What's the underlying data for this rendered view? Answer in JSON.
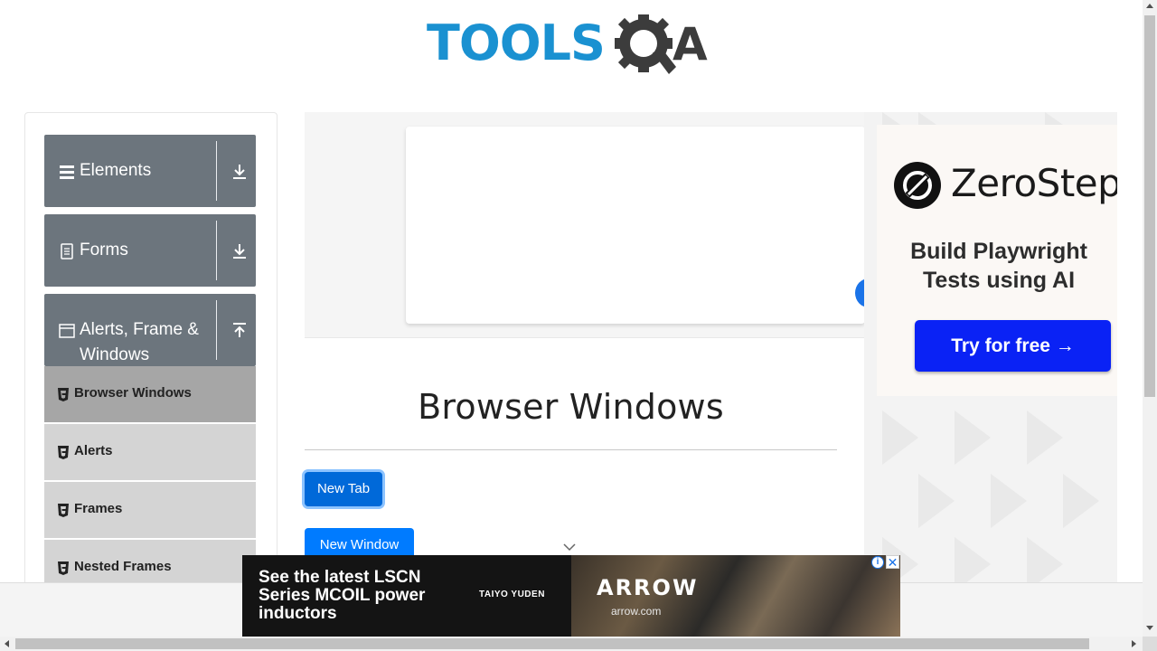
{
  "header": {
    "logo_text_left": "TOOLS",
    "logo_text_right": "A",
    "logo_icon": "gear-magnifier-icon"
  },
  "sidebar": {
    "groups": [
      {
        "label": "Elements",
        "icon": "hamburger-icon",
        "toggle_icon": "download-arrow-icon",
        "expanded": false
      },
      {
        "label": "Forms",
        "icon": "document-icon",
        "toggle_icon": "download-arrow-icon",
        "expanded": false
      },
      {
        "label_line1": "Alerts, Frame &",
        "label_line2": "Windows",
        "icon": "window-icon",
        "toggle_icon": "upload-arrow-icon",
        "expanded": true
      }
    ],
    "items": [
      {
        "label": "Browser Windows",
        "active": true,
        "icon": "html5-icon"
      },
      {
        "label": "Alerts",
        "active": false,
        "icon": "html5-icon"
      },
      {
        "label": "Frames",
        "active": false,
        "icon": "html5-icon"
      },
      {
        "label": "Nested Frames",
        "active": false,
        "icon": "html5-icon"
      }
    ]
  },
  "main": {
    "title": "Browser Windows",
    "buttons": {
      "new_tab": "New Tab",
      "new_window": "New Window"
    }
  },
  "right_ad": {
    "brand": "ZeroStep",
    "tagline_line1": "Build Playwright",
    "tagline_line2": "Tests using AI",
    "cta": "Try for free →"
  },
  "bottom_ad": {
    "headline": "See the latest LSCN Series MCOIL power inductors",
    "brand": "TAIYO YUDEN",
    "partner": "ARROW",
    "partner_url": "arrow.com"
  },
  "colors": {
    "primary_button": "#007bff",
    "sidebar_header": "#6c757d",
    "sidebar_item": "#d4d4d4",
    "sidebar_item_active": "#a6a6a6",
    "logo_blue": "#1a91d1",
    "logo_dark": "#3c3c3c",
    "zerostep_cta": "#0a22f5"
  }
}
